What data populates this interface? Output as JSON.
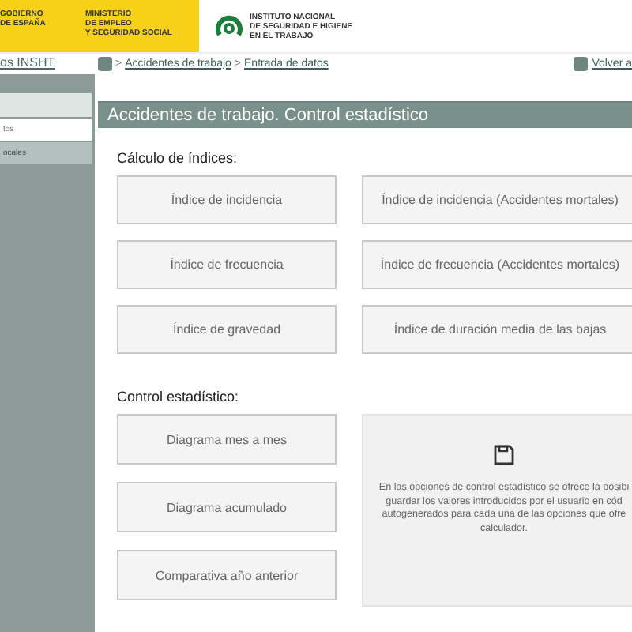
{
  "header": {
    "government_logo": [
      "GOBIERNO",
      "DE ESPAÑA"
    ],
    "ministry_logo": [
      "MINISTERIO",
      "DE EMPLEO",
      "Y SEGURIDAD SOCIAL"
    ],
    "institute_logo": [
      "INSTITUTO NACIONAL",
      "DE SEGURIDAD E HIGIENE",
      "EN EL TRABAJO"
    ]
  },
  "top_link": "os INSHT",
  "breadcrumb": {
    "items": [
      "Accidentes de trabajo",
      "Entrada de datos"
    ],
    "separator": ">"
  },
  "back_link": "Volver a",
  "sidebar": {
    "items": [
      {
        "selected": false,
        "kind": "blank"
      },
      {
        "label": "tos",
        "selected": true,
        "kind": "item"
      },
      {
        "label": "ocales",
        "selected": false,
        "kind": "item"
      }
    ]
  },
  "title": "Accidentes de trabajo. Control estadístico",
  "indices": {
    "heading": "Cálculo de índices:",
    "buttons": [
      "Índice de incidencia",
      "Índice de incidencia (Accidentes mortales)",
      "Índice de frecuencia",
      "Índice de frecuencia (Accidentes mortales)",
      "Índice de gravedad",
      "Índice de duración media de las bajas"
    ]
  },
  "control": {
    "heading": "Control estadístico:",
    "buttons": [
      "Diagrama mes a mes",
      "Diagrama acumulado",
      "Comparativa año anterior"
    ],
    "info": {
      "lines": [
        "En las opciones de control estadístico se ofrece la posibi",
        "guardar los valores introducidos por el usuario en cód",
        "autogenerados para cada una de las opciones que ofre",
        "calculador."
      ]
    }
  }
}
